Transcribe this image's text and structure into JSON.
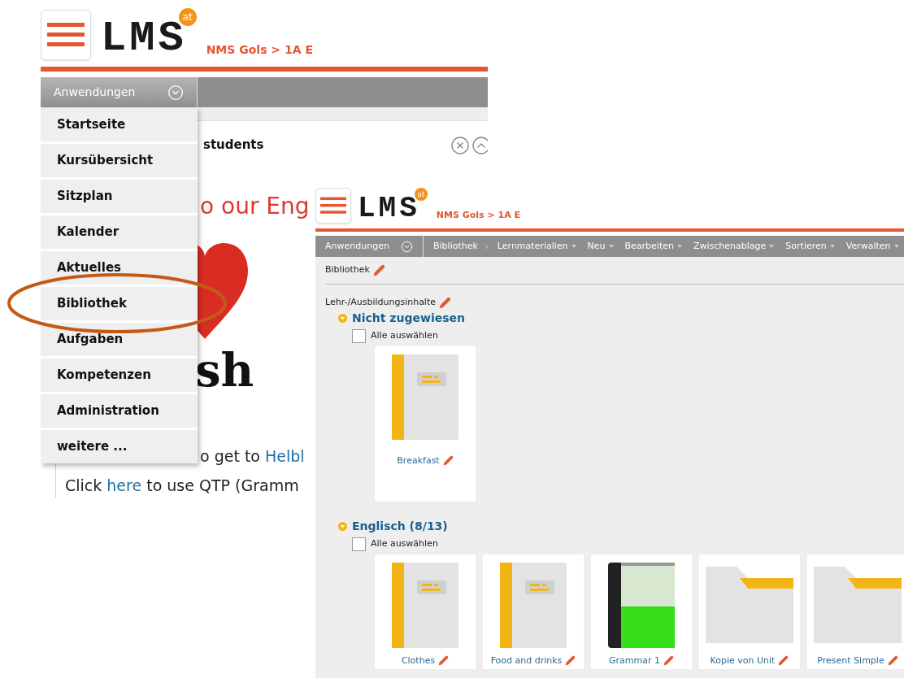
{
  "background_window": {
    "header": {
      "logo": "LMS",
      "logo_badge": "at",
      "breadcrumb": "NMS Gols > 1A E"
    },
    "menu_button": "Anwendungen",
    "menu_items": [
      "Startseite",
      "Kursübersicht",
      "Sitzplan",
      "Kalender",
      "Aktuelles",
      "Bibliothek",
      "Aufgaben",
      "Kompetenzen",
      "Administration",
      "weitere ..."
    ],
    "content": {
      "heading": "students",
      "welcome": "o our Eng",
      "title_fragment": "sh",
      "lines": [
        [
          {
            "text": "o get to ",
            "link": false
          },
          {
            "text": "Helbl",
            "link": true
          }
        ],
        [
          {
            "text": "Click ",
            "link": false
          },
          {
            "text": "here",
            "link": true
          },
          {
            "text": " to use QTP (Gramm",
            "link": false
          }
        ]
      ]
    }
  },
  "front_window": {
    "header": {
      "logo": "LMS",
      "logo_badge": "at",
      "breadcrumb": "NMS Gols > 1A E"
    },
    "nav": [
      {
        "label": "Anwendungen",
        "kind": "apps"
      },
      {
        "label": "Bibliothek",
        "kind": "crumb"
      },
      {
        "label": "Lernmaterialien",
        "kind": "dropdown"
      },
      {
        "label": "Neu",
        "kind": "dropdown"
      },
      {
        "label": "Bearbeiten",
        "kind": "dropdown"
      },
      {
        "label": "Zwischenablage",
        "kind": "dropdown"
      },
      {
        "label": "Sortieren",
        "kind": "dropdown"
      },
      {
        "label": "Verwalten",
        "kind": "dropdown"
      }
    ],
    "page_title": "Bibliothek",
    "section_title": "Lehr-/Ausbildungsinhalte",
    "groups": [
      {
        "title": "Nicht zugewiesen",
        "expanded": true,
        "select_all": {
          "label": "Alle auswählen",
          "checked": false
        },
        "items": [
          {
            "label": "Breakfast",
            "kind": "notebook"
          }
        ]
      },
      {
        "title": "Englisch (8/13)",
        "expanded": true,
        "select_all": {
          "label": "Alle auswählen",
          "checked": false
        },
        "items": [
          {
            "label": "Clothes",
            "kind": "notebook"
          },
          {
            "label": "Food and drinks",
            "kind": "notebook"
          },
          {
            "label": "Grammar 1",
            "kind": "book"
          },
          {
            "label": "Kopie von Unit",
            "kind": "folder"
          },
          {
            "label": "Present Simple",
            "kind": "folder"
          }
        ]
      }
    ]
  }
}
